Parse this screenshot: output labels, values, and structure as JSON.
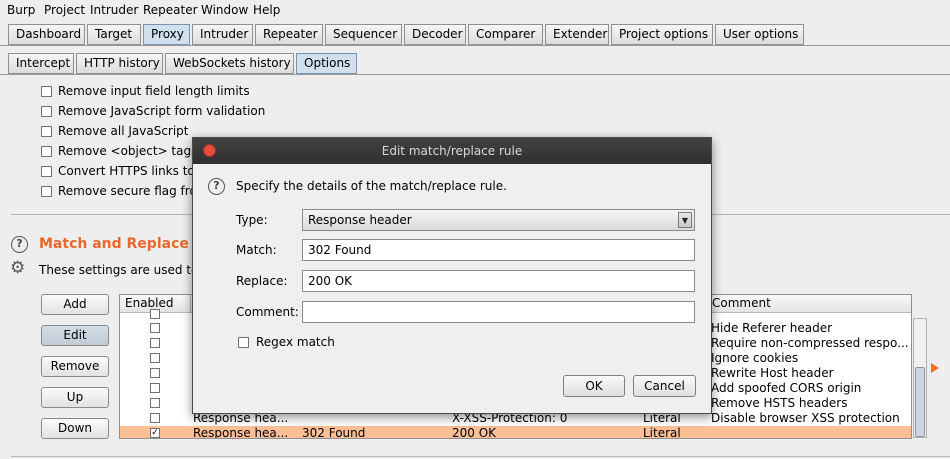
{
  "menu": [
    "Burp",
    "Project",
    "Intruder",
    "Repeater",
    "Window",
    "Help"
  ],
  "main_tabs": [
    "Dashboard",
    "Target",
    "Proxy",
    "Intruder",
    "Repeater",
    "Sequencer",
    "Decoder",
    "Comparer",
    "Extender",
    "Project options",
    "User options"
  ],
  "main_tabs_active": "Proxy",
  "sub_tabs": [
    "Intercept",
    "HTTP history",
    "WebSockets history",
    "Options"
  ],
  "sub_tabs_active": "Options",
  "options": [
    "Remove input field length limits",
    "Remove JavaScript form validation",
    "Remove all JavaScript",
    "Remove <object> tags",
    "Convert HTTPS links to",
    "Remove secure flag fron"
  ],
  "match_replace": {
    "title": "Match and Replace",
    "description": "These settings are used to",
    "buttons": [
      "Add",
      "Edit",
      "Remove",
      "Up",
      "Down"
    ],
    "columns": {
      "enabled": "Enabled",
      "comment": "Comment"
    },
    "rows": [
      {
        "enabled": false,
        "item": "",
        "match": "",
        "replace": "",
        "type": "",
        "comment": ""
      },
      {
        "enabled": false,
        "item": "",
        "match": "",
        "replace": "",
        "type": "",
        "comment": "Hide Referer header"
      },
      {
        "enabled": false,
        "item": "",
        "match": "",
        "replace": "",
        "type": "",
        "comment": "Require non-compressed respo..."
      },
      {
        "enabled": false,
        "item": "",
        "match": "",
        "replace": "",
        "type": "",
        "comment": "Ignore cookies"
      },
      {
        "enabled": false,
        "item": "",
        "match": "",
        "replace": "",
        "type": "",
        "comment": "Rewrite Host header"
      },
      {
        "enabled": false,
        "item": "",
        "match": "",
        "replace": "",
        "type": "",
        "comment": "Add spoofed CORS origin"
      },
      {
        "enabled": false,
        "item": "",
        "match": "",
        "replace": "",
        "type": "",
        "comment": "Remove HSTS headers"
      },
      {
        "enabled": false,
        "item": "Response hea...",
        "match": "",
        "replace": "X-XSS-Protection: 0",
        "type": "Literal",
        "comment": "Disable browser XSS protection"
      },
      {
        "enabled": true,
        "item": "Response hea...",
        "match": "302 Found",
        "replace": "200 OK",
        "type": "Literal",
        "comment": "",
        "selected": true
      }
    ]
  },
  "dialog": {
    "title": "Edit match/replace rule",
    "instructions": "Specify the details of the match/replace rule.",
    "type_label": "Type:",
    "type_value": "Response header",
    "match_label": "Match:",
    "match_value": "302 Found",
    "replace_label": "Replace:",
    "replace_value": "200 OK",
    "comment_label": "Comment:",
    "comment_value": "",
    "regex_label": "Regex match",
    "regex_checked": false,
    "ok_label": "OK",
    "cancel_label": "Cancel"
  },
  "colors": {
    "accent": "#e8682d",
    "selected_row": "#fcbf96",
    "dialog_titlebar": "#383838",
    "close_button": "#e74b3c"
  }
}
